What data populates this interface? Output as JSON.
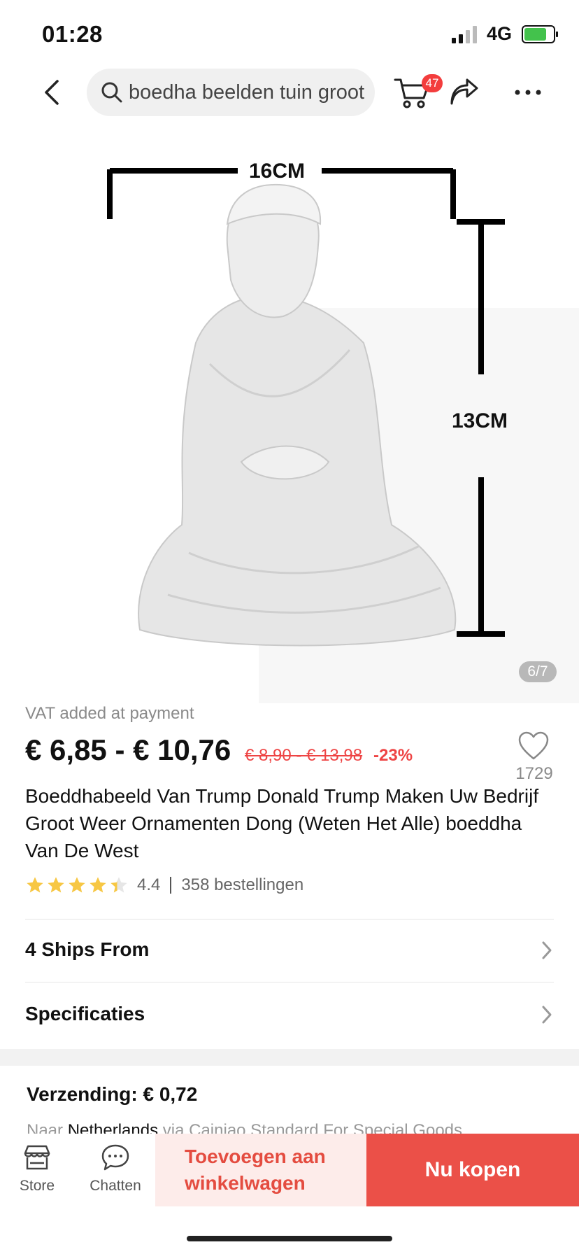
{
  "status": {
    "time": "01:28",
    "network": "4G"
  },
  "nav": {
    "search_text": "boedha beelden tuin groot",
    "cart_count": "47"
  },
  "gallery": {
    "dim_width": "16CM",
    "dim_height": "13CM",
    "page_indicator": "6/7"
  },
  "product": {
    "vat_note": "VAT added at payment",
    "price": "€ 6,85 - € 10,76",
    "original_price": "€ 8,90 - € 13,98",
    "discount": "-23%",
    "wishlist_count": "1729",
    "title": "Boeddhabeeld Van Trump Donald Trump Maken Uw Bedrijf Groot Weer Ornamenten Dong (Weten Het Alle) boeddha Van De West",
    "rating": "4.4",
    "rating_stars": 4.4,
    "orders": "358 bestellingen"
  },
  "rows": {
    "ships_from": "4 Ships From",
    "specs": "Specificaties"
  },
  "shipping": {
    "title": "Verzending: € 0,72",
    "prefix": "Naar ",
    "country": "Netherlands",
    "suffix": " via Cainiao Standard For Special Goods"
  },
  "bottom": {
    "store": "Store",
    "chat": "Chatten",
    "add_to_cart": "Toevoegen aan winkelwagen",
    "buy_now": "Nu kopen"
  },
  "colors": {
    "accent": "#eb5048",
    "badge": "#f33d3d",
    "star": "#f7c744"
  }
}
